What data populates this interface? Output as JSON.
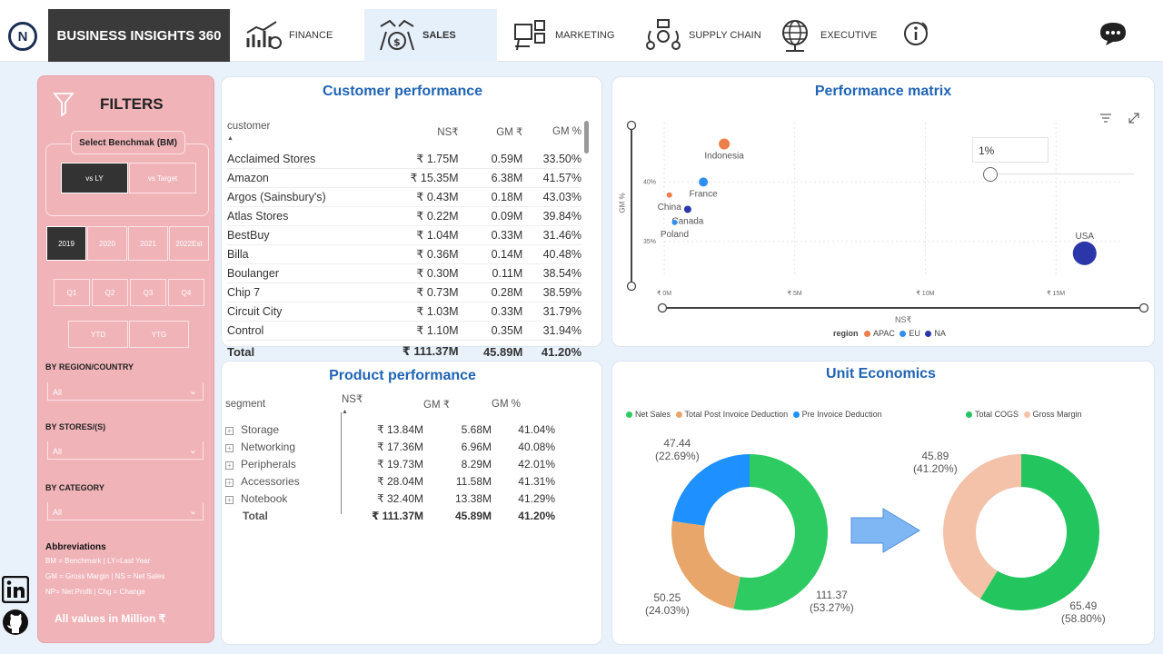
{
  "header": {
    "brand": "BUSINESS INSIGHTS 360",
    "tabs": [
      {
        "label": "FINANCE",
        "icon": "finance-chart-icon"
      },
      {
        "label": "SALES",
        "icon": "sales-money-icon",
        "active": true
      },
      {
        "label": "MARKETING",
        "icon": "marketing-board-icon"
      },
      {
        "label": "SUPPLY CHAIN",
        "icon": "supply-chain-icon"
      },
      {
        "label": "EXECUTIVE",
        "icon": "executive-globe-icon"
      }
    ]
  },
  "filters": {
    "title": "FILTERS",
    "benchmark_label": "Select Benchmak (BM)",
    "benchmark_options": [
      "vs LY",
      "vs Target"
    ],
    "years": [
      "2019",
      "2020",
      "2021",
      "2022Est"
    ],
    "quarters": [
      "Q1",
      "Q2",
      "Q3",
      "Q4"
    ],
    "periods": [
      "YTD",
      "YTG"
    ],
    "region_label": "BY REGION/COUNTRY",
    "region_value": "All",
    "stores_label": "BY STORES/(S)",
    "stores_value": "All",
    "category_label": "BY CATEGORY",
    "category_value": "All",
    "abbrev_title": "Abbreviations",
    "abbrev_lines": [
      "BM = Benchmark | LY=Last Year",
      "GM = Gross Margin | NS = Net Sales",
      "NP= Net Profit | Chg = Change"
    ],
    "footer": "All values in Million ₹"
  },
  "customer": {
    "title": "Customer performance",
    "columns": [
      "customer",
      "NS₹",
      "GM ₹",
      "GM %"
    ],
    "rows": [
      [
        "Acclaimed Stores",
        "₹ 1.75M",
        "0.59M",
        "33.50%"
      ],
      [
        "Amazon",
        "₹ 15.35M",
        "6.38M",
        "41.57%"
      ],
      [
        "Argos (Sainsbury's)",
        "₹ 0.43M",
        "0.18M",
        "43.03%"
      ],
      [
        "Atlas Stores",
        "₹ 0.22M",
        "0.09M",
        "39.84%"
      ],
      [
        "BestBuy",
        "₹ 1.04M",
        "0.33M",
        "31.46%"
      ],
      [
        "Billa",
        "₹ 0.36M",
        "0.14M",
        "40.48%"
      ],
      [
        "Boulanger",
        "₹ 0.30M",
        "0.11M",
        "38.54%"
      ],
      [
        "Chip 7",
        "₹ 0.73M",
        "0.28M",
        "38.59%"
      ],
      [
        "Circuit City",
        "₹ 1.03M",
        "0.33M",
        "31.79%"
      ],
      [
        "Control",
        "₹ 1.10M",
        "0.35M",
        "31.94%"
      ]
    ],
    "total": [
      "Total",
      "₹ 111.37M",
      "45.89M",
      "41.20%"
    ]
  },
  "matrix": {
    "title": "Performance matrix",
    "slider_value": "1%",
    "xlabel": "NS₹",
    "ylabel": "GM %",
    "legend_title": "region",
    "legend": [
      {
        "name": "APAC",
        "color": "#ee7d4a"
      },
      {
        "name": "EU",
        "color": "#2f8ff0"
      },
      {
        "name": "NA",
        "color": "#2b36a8"
      }
    ],
    "x_ticks": [
      "₹ 0M",
      "₹ 5M",
      "₹ 10M",
      "₹ 15M"
    ],
    "y_ticks": [
      "40%",
      "35%"
    ]
  },
  "chart_data": [
    {
      "type": "scatter",
      "title": "Performance matrix",
      "xlabel": "NS₹",
      "ylabel": "GM %",
      "xlim": [
        0,
        17.5
      ],
      "ylim": [
        32,
        45
      ],
      "points": [
        {
          "label": "Indonesia",
          "x": 2.3,
          "y": 43.2,
          "region": "APAC",
          "size": 6
        },
        {
          "label": "France",
          "x": 1.5,
          "y": 40.0,
          "region": "EU",
          "size": 5
        },
        {
          "label": "China",
          "x": 0.2,
          "y": 38.9,
          "region": "APAC",
          "size": 3
        },
        {
          "label": "Canada",
          "x": 0.9,
          "y": 37.7,
          "region": "NA",
          "size": 4
        },
        {
          "label": "Poland",
          "x": 0.4,
          "y": 36.6,
          "region": "EU",
          "size": 3
        },
        {
          "label": "USA",
          "x": 16.1,
          "y": 34.0,
          "region": "NA",
          "size": 13
        }
      ]
    },
    {
      "type": "pie",
      "title": "Unit Economics",
      "labels": [
        "Net Sales",
        "Total Post Invoice Deduction",
        "Pre Invoice Deduction"
      ],
      "values": [
        111.37,
        50.25,
        47.44
      ],
      "percents": [
        "(53.27%)",
        "(24.03%)",
        "(22.69%)"
      ],
      "colors": [
        "#2ecb62",
        "#e8a66a",
        "#1e90ff"
      ]
    },
    {
      "type": "pie",
      "labels": [
        "Total COGS",
        "Gross Margin"
      ],
      "values": [
        65.49,
        45.89
      ],
      "percents": [
        "(58.80%)",
        "(41.20%)"
      ],
      "colors": [
        "#22c55e",
        "#f3c2a8"
      ]
    }
  ],
  "product": {
    "title": "Product performance",
    "columns": [
      "segment",
      "NS₹",
      "GM ₹",
      "GM %"
    ],
    "rows": [
      [
        "Storage",
        "₹ 13.84M",
        "5.68M",
        "41.04%"
      ],
      [
        "Networking",
        "₹ 17.36M",
        "6.96M",
        "40.08%"
      ],
      [
        "Peripherals",
        "₹ 19.73M",
        "8.29M",
        "42.01%"
      ],
      [
        "Accessories",
        "₹ 28.04M",
        "11.58M",
        "41.31%"
      ],
      [
        "Notebook",
        "₹ 32.40M",
        "13.38M",
        "41.29%"
      ]
    ],
    "total": [
      "Total",
      "₹ 111.37M",
      "45.89M",
      "41.20%"
    ]
  },
  "unit": {
    "title": "Unit Economics",
    "legend1": [
      "Net Sales",
      "Total Post Invoice Deduction",
      "Pre Invoice Deduction"
    ],
    "legend2": [
      "Total COGS",
      "Gross Margin"
    ],
    "d1": [
      {
        "v": "111.37",
        "p": "(53.27%)"
      },
      {
        "v": "50.25",
        "p": "(24.03%)"
      },
      {
        "v": "47.44",
        "p": "(22.69%)"
      }
    ],
    "d2": [
      {
        "v": "65.49",
        "p": "(58.80%)"
      },
      {
        "v": "45.89",
        "p": "(41.20%)"
      }
    ]
  },
  "colors": {
    "accent": "#1f64b4",
    "filter_bg": "#f0b3b8",
    "brand_bg": "#3a3a3a"
  }
}
